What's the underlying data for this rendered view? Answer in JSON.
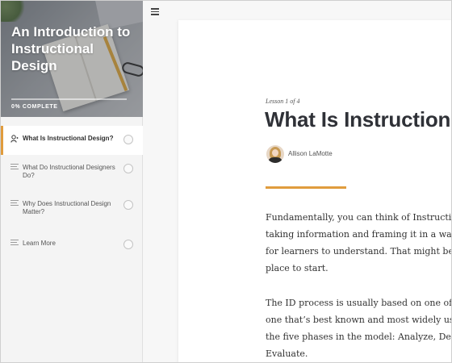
{
  "sidebar": {
    "course_title": "An Introduction to Instructional Design",
    "progress_label": "0% COMPLETE",
    "progress_value": 0,
    "lessons": [
      {
        "label": "What Is Instructional Design?",
        "icon": "user-icon",
        "active": true
      },
      {
        "label": "What Do Instructional Designers Do?",
        "icon": "lines-icon",
        "active": false
      },
      {
        "label": "Why Does Instructional Design Matter?",
        "icon": "lines-icon",
        "active": false
      },
      {
        "label": "Learn More",
        "icon": "lines-icon",
        "active": false
      }
    ]
  },
  "topbar": {
    "menu_icon": "hamburger-menu-icon"
  },
  "lesson": {
    "count": "Lesson 1 of 4",
    "title": "What Is Instructiona",
    "author": "Allison LaMotte",
    "paragraphs": [
      [
        "Fundamentally, you can think of Instructio",
        "taking information and framing it in a way",
        "for learners to understand. That might be a",
        "place to start."
      ],
      [
        "The ID process is usually based on one of n",
        "one that’s best known and most widely use",
        "the five phases in the model: Analyze, Desi",
        "Evaluate."
      ]
    ]
  },
  "colors": {
    "accent": "#e09c3d",
    "title": "#2f3137",
    "sidebar_bg": "#f4f4f4"
  }
}
